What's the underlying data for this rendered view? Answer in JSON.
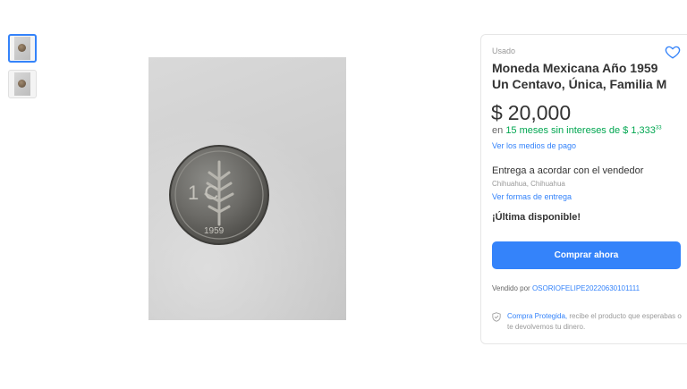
{
  "product": {
    "condition": "Usado",
    "title_line1": "Moneda Mexicana Año 1959",
    "title_line2": "Un Centavo, Única, Familia M",
    "price_currency": "$",
    "price_amount": "20,000",
    "installments": {
      "prefix": "en",
      "plan": "15 meses sin intereses de $ 1,333",
      "cents": "33"
    },
    "payment_link": "Ver los medios de pago",
    "delivery_text": "Entrega a acordar con el vendedor",
    "location": "Chihuahua, Chihuahua",
    "shipping_link": "Ver formas de entrega",
    "stock_text": "¡Última disponible!",
    "buy_button": "Comprar ahora",
    "seller_prefix": "Vendido por",
    "seller_name": "OSORIOFELIPE20220630101111",
    "protection_link": "Compra Protegida,",
    "protection_text": "recibe el producto que esperabas o te devolvemos tu dinero."
  },
  "coin": {
    "denomination": "1 C",
    "year": "1959"
  },
  "colors": {
    "accent": "#3483fa",
    "green": "#00a650"
  },
  "icons": {
    "favorite": "heart-icon",
    "protection": "shield-check-icon"
  }
}
